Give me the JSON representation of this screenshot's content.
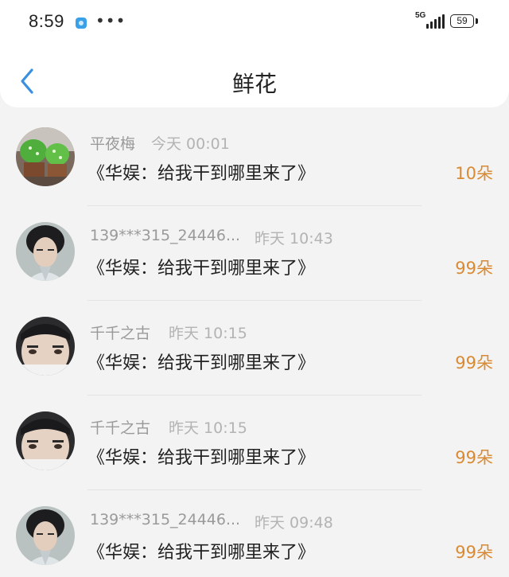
{
  "status_bar": {
    "time": "8:59",
    "more": "•••",
    "network": "5G",
    "battery": "59",
    "icons": [
      "app-notification-icon",
      "signal-icon",
      "battery-icon"
    ]
  },
  "header": {
    "title": "鲜花",
    "back_icon": "chevron-left-icon"
  },
  "colors": {
    "accent": "#3a8fe0",
    "count": "#d98a32",
    "name": "#9a9a9a",
    "time": "#b3b3b3"
  },
  "list": [
    {
      "sender": "平夜梅",
      "time": "今天 00:01",
      "message": "《华娱：给我干到哪里来了》",
      "count": "10朵"
    },
    {
      "sender": "139***315_24446...",
      "time": "昨天 10:43",
      "message": "《华娱：给我干到哪里来了》",
      "count": "99朵"
    },
    {
      "sender": "千千之古",
      "time": "昨天 10:15",
      "message": "《华娱：给我干到哪里来了》",
      "count": "99朵"
    },
    {
      "sender": "千千之古",
      "time": "昨天 10:15",
      "message": "《华娱：给我干到哪里来了》",
      "count": "99朵"
    },
    {
      "sender": "139***315_24446...",
      "time": "昨天 09:48",
      "message": "《华娱：给我干到哪里来了》",
      "count": "99朵"
    }
  ]
}
